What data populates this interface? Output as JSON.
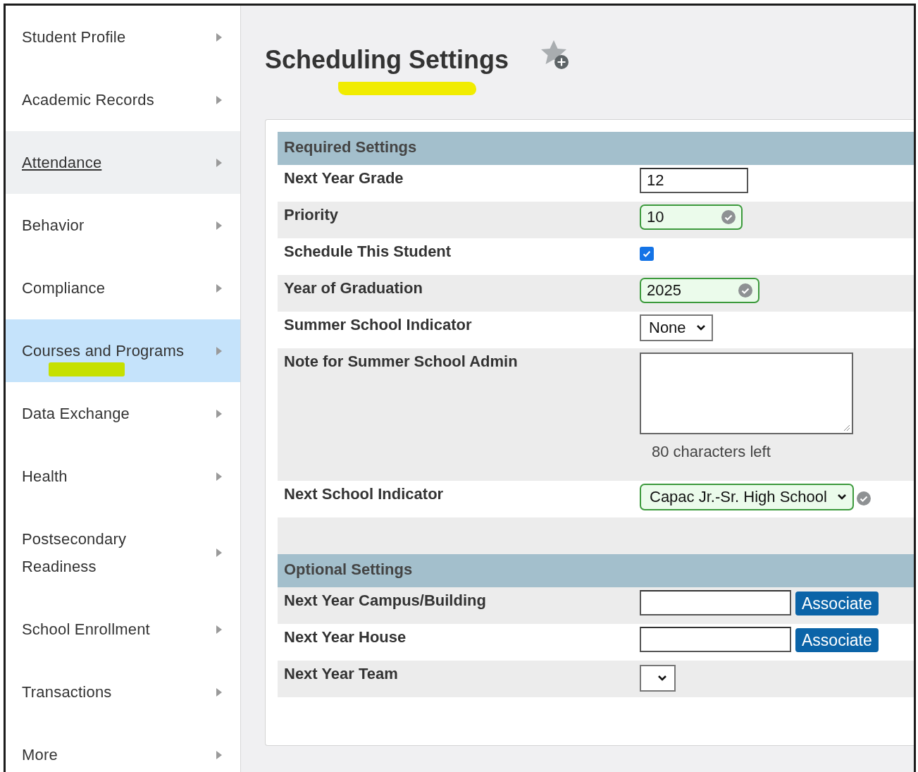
{
  "sidebar": {
    "items": [
      {
        "label": "Student Profile",
        "selected": false,
        "hovered": false,
        "highlighted": false
      },
      {
        "label": "Academic Records",
        "selected": false,
        "hovered": false,
        "highlighted": false
      },
      {
        "label": "Attendance",
        "selected": false,
        "hovered": true,
        "highlighted": false
      },
      {
        "label": "Behavior",
        "selected": false,
        "hovered": false,
        "highlighted": false
      },
      {
        "label": "Compliance",
        "selected": false,
        "hovered": false,
        "highlighted": false
      },
      {
        "label": "Courses and Programs",
        "selected": true,
        "hovered": false,
        "highlighted": true
      },
      {
        "label": "Data Exchange",
        "selected": false,
        "hovered": false,
        "highlighted": false
      },
      {
        "label": "Health",
        "selected": false,
        "hovered": false,
        "highlighted": false
      },
      {
        "label": "Postsecondary Readiness",
        "selected": false,
        "hovered": false,
        "highlighted": false
      },
      {
        "label": "School Enrollment",
        "selected": false,
        "hovered": false,
        "highlighted": false
      },
      {
        "label": "Transactions",
        "selected": false,
        "hovered": false,
        "highlighted": false
      },
      {
        "label": "More",
        "selected": false,
        "hovered": false,
        "highlighted": false
      }
    ]
  },
  "page": {
    "title": "Scheduling Settings",
    "highlighted": true,
    "favorite": false
  },
  "sections": [
    {
      "title": "Required Settings",
      "rows": [
        {
          "label": "Next Year Grade",
          "kind": "input",
          "value": "12",
          "valid": false,
          "shaded": false
        },
        {
          "label": "Priority",
          "kind": "input",
          "value": "10",
          "valid": true,
          "shaded": true
        },
        {
          "label": "Schedule This Student",
          "kind": "checkbox",
          "checked": true,
          "shaded": false
        },
        {
          "label": "Year of Graduation",
          "kind": "input",
          "value": "2025",
          "valid": true,
          "shaded": true
        },
        {
          "label": "Summer School Indicator",
          "kind": "select",
          "value": "None",
          "valid": false,
          "shaded": false
        },
        {
          "label": "Note for Summer School Admin",
          "kind": "textarea",
          "hint": "80 characters left",
          "shaded": true
        },
        {
          "label": "Next School Indicator",
          "kind": "select",
          "value": "Capac Jr.-Sr. High School",
          "valid": true,
          "shaded": false
        },
        {
          "kind": "spacer",
          "shaded": true
        }
      ]
    },
    {
      "title": "Optional Settings",
      "rows": [
        {
          "label": "Next Year Campus/Building",
          "kind": "associate",
          "button": "Associate",
          "shaded": true
        },
        {
          "label": "Next Year House",
          "kind": "associate",
          "button": "Associate",
          "shaded": false
        },
        {
          "label": "Next Year Team",
          "kind": "select",
          "valid": false,
          "shaded": true
        }
      ]
    }
  ]
}
